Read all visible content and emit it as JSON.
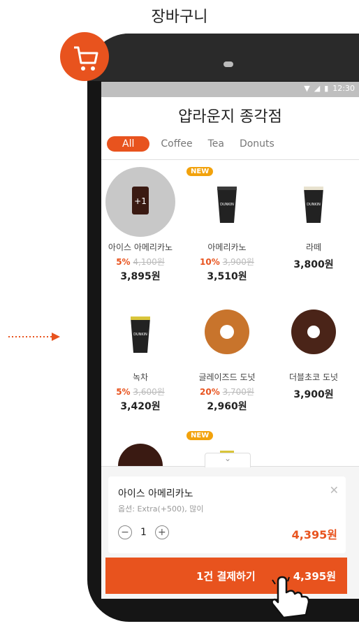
{
  "caption": "장바구니",
  "status": {
    "time": "12:30"
  },
  "store_title": "얍라운지 종각점",
  "tabs": [
    {
      "label": "All",
      "active": true
    },
    {
      "label": "Coffee",
      "active": false
    },
    {
      "label": "Tea",
      "active": false
    },
    {
      "label": "Donuts",
      "active": false
    }
  ],
  "products": [
    {
      "name": "아이스 아메리카노",
      "discount_rate": "5%",
      "original_price": "4,100원",
      "price": "3,895원",
      "badge": "",
      "overlay": "+1"
    },
    {
      "name": "아메리카노",
      "discount_rate": "10%",
      "original_price": "3,900원",
      "price": "3,510원",
      "badge": "NEW"
    },
    {
      "name": "라떼",
      "discount_rate": "",
      "original_price": "",
      "price": "3,800원",
      "badge": ""
    },
    {
      "name": "녹차",
      "discount_rate": "5%",
      "original_price": "3,600원",
      "price": "3,420원",
      "badge": ""
    },
    {
      "name": "글레이즈드 도넛",
      "discount_rate": "20%",
      "original_price": "3,700원",
      "price": "2,960원",
      "badge": ""
    },
    {
      "name": "더블초코 도넛",
      "discount_rate": "",
      "original_price": "",
      "price": "3,900원",
      "badge": ""
    },
    {
      "name": "",
      "badge": ""
    },
    {
      "name": "",
      "badge": "NEW"
    }
  ],
  "cart": {
    "item_name": "아이스 아메리카노",
    "options": "옵션: Extra(+500), 많이",
    "quantity": "1",
    "item_total": "4,395원",
    "minus": "−",
    "plus": "+",
    "close": "✕"
  },
  "pay_button": {
    "label": "1건 결제하기",
    "amount": "4,395원"
  },
  "colors": {
    "accent": "#e8531e",
    "badge": "#f2a20c"
  },
  "icons": [
    "cart-icon",
    "wifi-icon",
    "signal-icon",
    "battery-icon",
    "chevron-down-icon",
    "close-icon",
    "hand-pointer-icon",
    "dotted-arrow-icon"
  ]
}
